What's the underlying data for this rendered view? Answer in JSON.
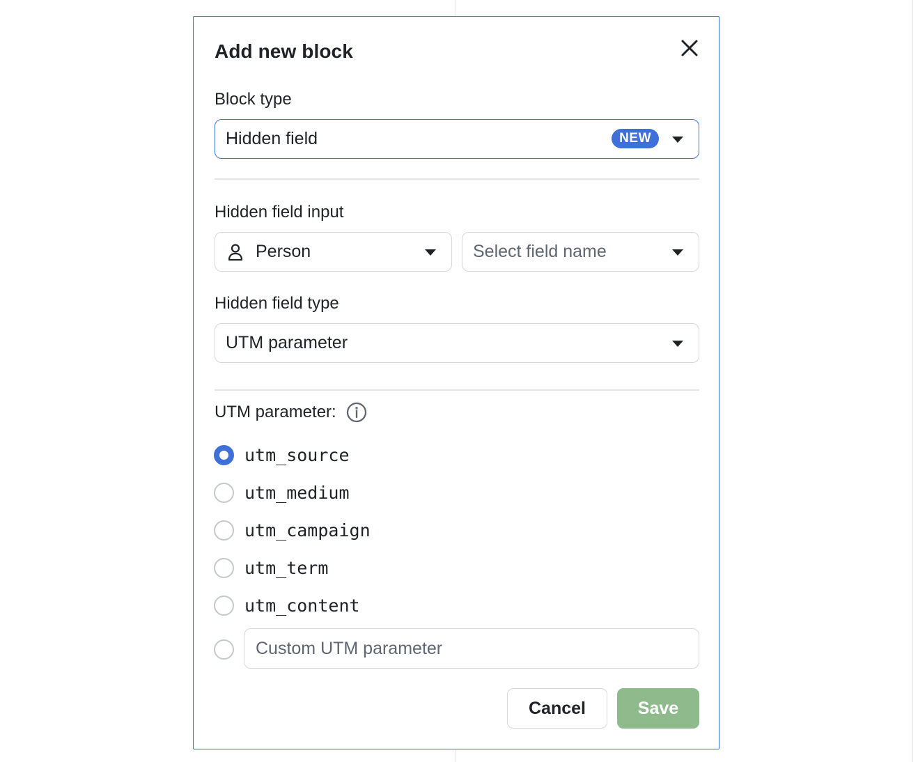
{
  "modal": {
    "title": "Add new block",
    "close_icon": "close-icon"
  },
  "block_type": {
    "label": "Block type",
    "value": "Hidden field",
    "badge": "NEW"
  },
  "hidden_field_input": {
    "label": "Hidden field input",
    "entity_value": "Person",
    "entity_icon": "person-icon",
    "field_placeholder": "Select field name"
  },
  "hidden_field_type": {
    "label": "Hidden field type",
    "value": "UTM parameter"
  },
  "utm": {
    "label": "UTM parameter:",
    "info_icon": "info-icon",
    "options": [
      "utm_source",
      "utm_medium",
      "utm_campaign",
      "utm_term",
      "utm_content"
    ],
    "selected": "utm_source",
    "custom_placeholder": "Custom UTM parameter"
  },
  "actions": {
    "cancel": "Cancel",
    "save": "Save"
  },
  "colors": {
    "accent": "#3f6fd8",
    "save_disabled": "#8fbb8c"
  }
}
